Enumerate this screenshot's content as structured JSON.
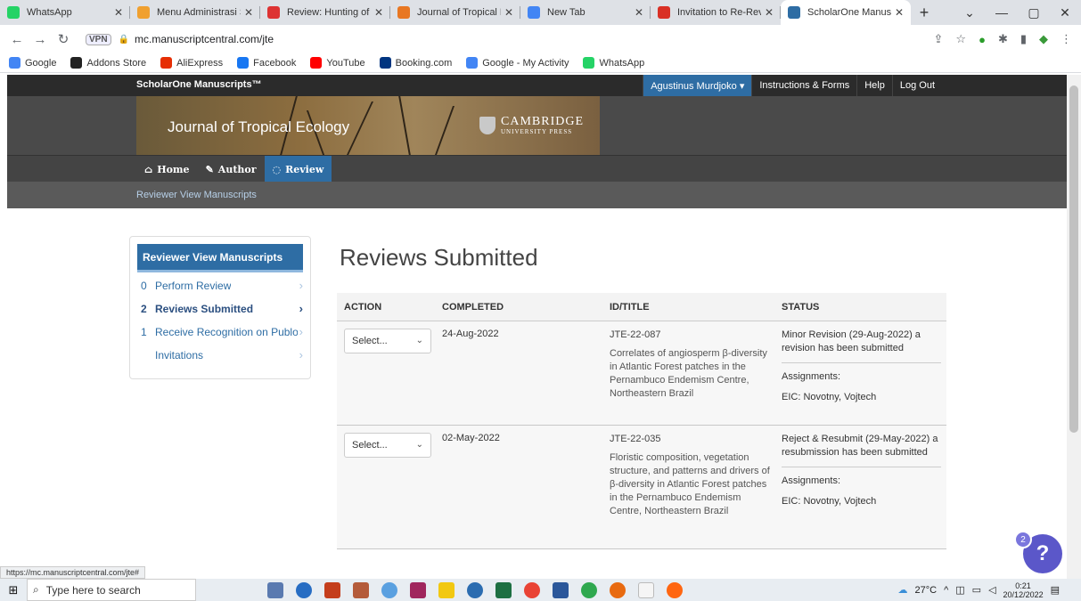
{
  "browser": {
    "tabs": [
      {
        "label": "WhatsApp",
        "icon": "whatsapp-icon",
        "color": "#25d366",
        "active": false
      },
      {
        "label": "Menu Administrasi Si",
        "icon": "menu-admin-icon",
        "color": "#f0a030",
        "active": false
      },
      {
        "label": "Review: Hunting of w",
        "icon": "review-icon",
        "color": "#d33",
        "active": false
      },
      {
        "label": "Journal of Tropical Ec",
        "icon": "journal-icon",
        "color": "#e87722",
        "active": false
      },
      {
        "label": "New Tab",
        "icon": "chrome-icon",
        "color": "#4285f4",
        "active": false
      },
      {
        "label": "Invitation to Re-Revie",
        "icon": "gmail-icon",
        "color": "#d93025",
        "active": false
      },
      {
        "label": "ScholarOne Manuscri",
        "icon": "scholarone-icon",
        "color": "#2e6da4",
        "active": true
      }
    ],
    "url": "mc.manuscriptcentral.com/jte",
    "vpn_label": "VPN",
    "bookmarks": [
      {
        "label": "Google",
        "icon": "google-icon",
        "color": "#4285f4"
      },
      {
        "label": "Addons Store",
        "icon": "addons-icon",
        "color": "#222"
      },
      {
        "label": "AliExpress",
        "icon": "aliexpress-icon",
        "color": "#e62e04"
      },
      {
        "label": "Facebook",
        "icon": "facebook-icon",
        "color": "#1877f2"
      },
      {
        "label": "YouTube",
        "icon": "youtube-icon",
        "color": "#ff0000"
      },
      {
        "label": "Booking.com",
        "icon": "booking-icon",
        "color": "#003580"
      },
      {
        "label": "Google - My Activity",
        "icon": "google-icon",
        "color": "#4285f4"
      },
      {
        "label": "WhatsApp",
        "icon": "whatsapp-icon",
        "color": "#25d366"
      }
    ]
  },
  "site": {
    "brand": "ScholarOne Manuscripts™",
    "user_menu": "Agustinus Murdjoko ▾",
    "top_links": [
      "Instructions & Forms",
      "Help",
      "Log Out"
    ],
    "journal_title": "Journal of Tropical Ecology",
    "publisher_line1": "CAMBRIDGE",
    "publisher_line2": "UNIVERSITY PRESS",
    "main_nav": [
      {
        "label": "Home",
        "icon": "home-icon",
        "glyph": "⌂",
        "active": false
      },
      {
        "label": "Author",
        "icon": "pencil-icon",
        "glyph": "✎",
        "active": false
      },
      {
        "label": "Review",
        "icon": "speech-bubble-icon",
        "glyph": "◌",
        "active": true
      }
    ],
    "sub_nav": "Reviewer View Manuscripts"
  },
  "sidebar": {
    "title": "Reviewer View Manuscripts",
    "items": [
      {
        "count": "0",
        "label": "Perform Review",
        "active": false
      },
      {
        "count": "2",
        "label": "Reviews Submitted",
        "active": true
      },
      {
        "count": "1",
        "label": "Receive Recognition on Publons",
        "active": false
      },
      {
        "count": "",
        "label": "Invitations",
        "active": false
      }
    ]
  },
  "main": {
    "title": "Reviews Submitted",
    "columns": [
      "ACTION",
      "COMPLETED",
      "ID/TITLE",
      "STATUS"
    ],
    "rows": [
      {
        "select_placeholder": "Select...",
        "completed": "24-Aug-2022",
        "id": "JTE-22-087",
        "title": "Correlates of angiosperm β-diversity in Atlantic Forest patches in the Pernambuco Endemism Centre, Northeastern Brazil",
        "status": "Minor Revision (29-Aug-2022) a revision has been submitted",
        "assignments_label": "Assignments:",
        "assignment": "EIC: Novotny, Vojtech"
      },
      {
        "select_placeholder": "Select...",
        "completed": "02-May-2022",
        "id": "JTE-22-035",
        "title": "Floristic composition, vegetation structure, and patterns and drivers of β-diversity in Atlantic Forest patches in the Pernambuco Endemism Centre, Northeastern Brazil",
        "status": "Reject & Resubmit (29-May-2022) a resubmission has been submitted",
        "assignments_label": "Assignments:",
        "assignment": "EIC: Novotny, Vojtech"
      }
    ]
  },
  "status_url": "https://mc.manuscriptcentral.com/jte#",
  "help_badge": "2",
  "help_glyph": "?",
  "taskbar": {
    "search_placeholder": "Type here to search",
    "weather": "27°C",
    "time": "0:21",
    "date": "20/12/2022"
  }
}
